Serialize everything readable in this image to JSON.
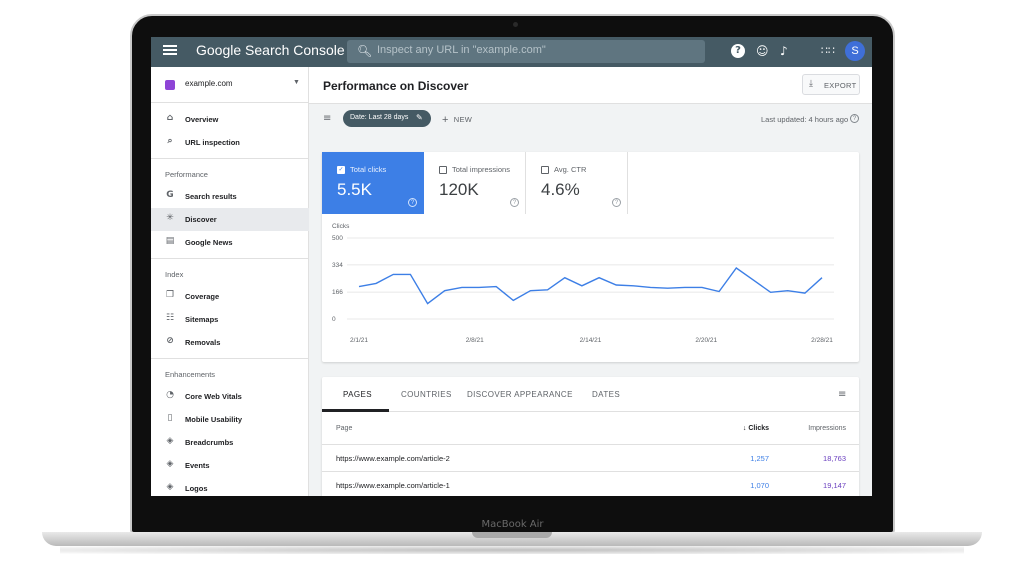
{
  "device": {
    "label": "MacBook Air"
  },
  "topbar": {
    "brand": "Google Search Console",
    "search_placeholder": "Inspect any URL in \"example.com\"",
    "avatar_initial": "S"
  },
  "sidebar": {
    "property": "example.com",
    "items_top": [
      {
        "label": "Overview",
        "icon": "home-icon"
      },
      {
        "label": "URL inspection",
        "icon": "search-icon"
      }
    ],
    "sections": [
      {
        "title": "Performance",
        "items": [
          {
            "label": "Search results",
            "icon": "google-g-icon"
          },
          {
            "label": "Discover",
            "icon": "asterisk-icon",
            "active": true
          },
          {
            "label": "Google News",
            "icon": "news-icon"
          }
        ]
      },
      {
        "title": "Index",
        "items": [
          {
            "label": "Coverage",
            "icon": "copy-icon"
          },
          {
            "label": "Sitemaps",
            "icon": "sitemap-icon"
          },
          {
            "label": "Removals",
            "icon": "hidden-eye-icon"
          }
        ]
      },
      {
        "title": "Enhancements",
        "items": [
          {
            "label": "Core Web Vitals",
            "icon": "gauge-icon"
          },
          {
            "label": "Mobile Usability",
            "icon": "phone-icon"
          },
          {
            "label": "Breadcrumbs",
            "icon": "layers-icon"
          },
          {
            "label": "Events",
            "icon": "layers-icon"
          },
          {
            "label": "Logos",
            "icon": "layers-icon"
          }
        ]
      }
    ]
  },
  "header": {
    "title": "Performance on Discover",
    "export_label": "EXPORT"
  },
  "filters": {
    "date_chip": "Date: Last 28 days",
    "new_label": "NEW",
    "last_updated": "Last updated: 4 hours ago"
  },
  "metrics": [
    {
      "label": "Total clicks",
      "value": "5.5K",
      "selected": true
    },
    {
      "label": "Total impressions",
      "value": "120K",
      "selected": false
    },
    {
      "label": "Avg. CTR",
      "value": "4.6%",
      "selected": false
    }
  ],
  "chart_data": {
    "type": "line",
    "ylabel": "Clicks",
    "yticks": [
      0,
      166,
      334,
      500
    ],
    "ylim": [
      0,
      500
    ],
    "xtick_labels": [
      "2/1/21",
      "2/8/21",
      "2/14/21",
      "2/20/21",
      "2/28/21"
    ],
    "grid": true,
    "series_color": "#3d7fe6",
    "series": [
      {
        "values": [
          200,
          220,
          275,
          275,
          95,
          175,
          195,
          195,
          200,
          115,
          175,
          180,
          255,
          205,
          255,
          210,
          205,
          195,
          190,
          195,
          195,
          170,
          315,
          240,
          165,
          175,
          160,
          255
        ]
      }
    ]
  },
  "table": {
    "tabs": [
      "PAGES",
      "COUNTRIES",
      "DISCOVER APPEARANCE",
      "DATES"
    ],
    "columns": {
      "page": "Page",
      "clicks": "Clicks",
      "impressions": "Impressions"
    },
    "rows": [
      {
        "page": "https://www.example.com/article-2",
        "clicks": "1,257",
        "impressions": "18,763"
      },
      {
        "page": "https://www.example.com/article-1",
        "clicks": "1,070",
        "impressions": "19,147"
      }
    ]
  }
}
